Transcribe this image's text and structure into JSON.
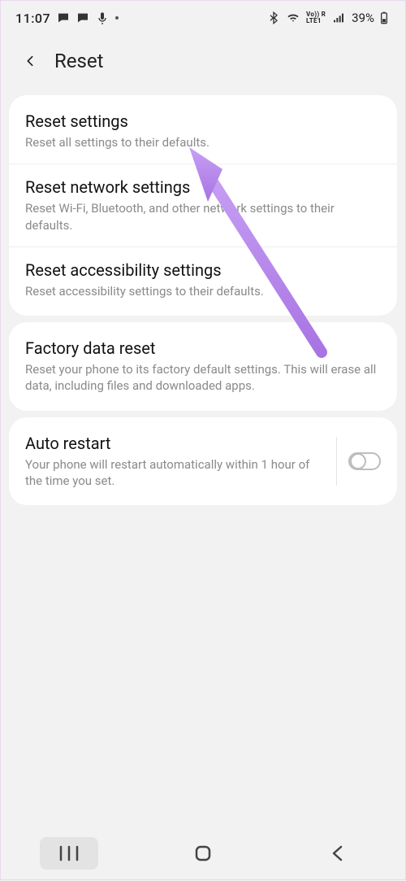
{
  "status": {
    "time": "11:07",
    "notif_icons": [
      "chat-icon",
      "chat-icon",
      "mic-icon",
      "dot-icon"
    ],
    "lte_top": "Vo)) R",
    "lte_bot": "LTE1",
    "battery_pct": "39%"
  },
  "header": {
    "title": "Reset"
  },
  "groups": [
    {
      "items": [
        {
          "title": "Reset settings",
          "desc": "Reset all settings to their defaults."
        },
        {
          "title": "Reset network settings",
          "desc": "Reset Wi-Fi, Bluetooth, and other network settings to their defaults."
        },
        {
          "title": "Reset accessibility settings",
          "desc": "Reset accessibility settings to their defaults."
        }
      ]
    },
    {
      "items": [
        {
          "title": "Factory data reset",
          "desc": "Reset your phone to its factory default settings. This will erase all data, including files and downloaded apps."
        }
      ]
    },
    {
      "items": [
        {
          "title": "Auto restart",
          "desc": "Your phone will restart automatically within 1 hour of the time you set.",
          "toggle": false
        }
      ]
    }
  ],
  "annotation": {
    "arrow_color": "#a874e3"
  }
}
